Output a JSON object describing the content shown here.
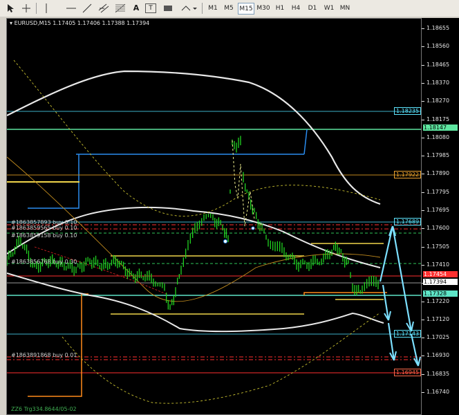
{
  "toolbar": {
    "cursor_icon": "cursor-arrow-icon",
    "crosshair_icon": "crosshair-icon",
    "vline_icon": "vertical-line-icon",
    "hline_icon": "horizontal-line-icon",
    "trend_icon": "trendline-icon",
    "channel_icon": "channel-icon",
    "fibo_icon": "fibonacci-icon",
    "text_label": "A",
    "text_box_label": "T",
    "rect_icon": "rectangle-icon",
    "shapes_icon": "shapes-dropdown-icon",
    "timeframes": [
      "M1",
      "M5",
      "M15",
      "M30",
      "H1",
      "H4",
      "D1",
      "W1",
      "MN"
    ],
    "active_timeframe": "M15"
  },
  "chart": {
    "symbol_info": "EURUSD,M15  1.17405 1.17406 1.17388 1.17394",
    "price_scale": [
      "1.18655",
      "1.18560",
      "1.18465",
      "1.18370",
      "1.18270",
      "1.18175",
      "1.18080",
      "1.17985",
      "1.17890",
      "1.17795",
      "1.17695",
      "1.17600",
      "1.17505",
      "1.17410",
      "1.17315",
      "1.17220",
      "1.17120",
      "1.17025",
      "1.16930",
      "1.16835",
      "1.16740"
    ],
    "price_markers": {
      "line_1": "1.18235",
      "line_2": "1.18147",
      "line_3": "1.17922",
      "line_4": "1.17689",
      "current_red": "1.17454",
      "current_price": "1.17394",
      "line_5": "1.17328",
      "line_6": "1.17143",
      "line_7": "1.16945"
    },
    "order_labels": [
      "#1863857893 buy 0.10",
      "#1863859565 buy 0.10",
      "#1863859158 buy 0.10",
      "#1863856768 buy 0.30",
      "#1863891868 buy 0.01"
    ],
    "footer_label": "ZZ6 Trg334.8644/05-02",
    "colors": {
      "background": "#000000",
      "candle": "#21d421",
      "bollinger": "#ffffff",
      "cyan": "#5ee6ff",
      "yellow": "#f0d54a",
      "orange": "#ff8a1a",
      "red": "#ff3030",
      "blue": "#2a8df0"
    }
  }
}
